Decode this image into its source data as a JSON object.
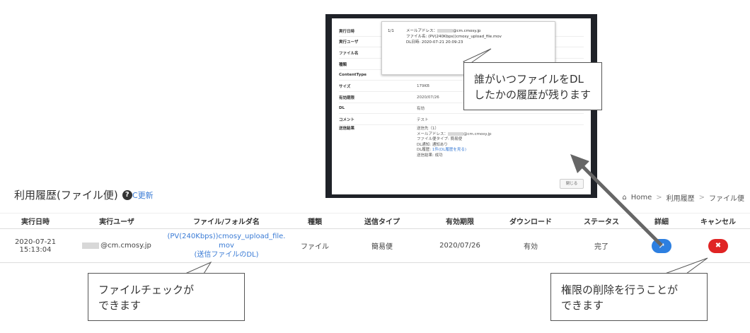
{
  "page": {
    "title": "利用履歴(ファイル便)",
    "help_icon": "?",
    "refresh_label": "更新",
    "refresh_icon": "C"
  },
  "breadcrumb": {
    "items": [
      "Home",
      "利用履歴",
      "ファイル便"
    ],
    "separator": ">"
  },
  "table": {
    "headers": [
      "実行日時",
      "実行ユーザ",
      "ファイル/フォルダ名",
      "種類",
      "送信タイプ",
      "有効期限",
      "ダウンロード",
      "ステータス",
      "詳細",
      "キャンセル"
    ],
    "row": {
      "datetime": "2020-07-21 15:13:04",
      "user": "@cm.cmosy.jp",
      "file_line1": "(PV(240Kbps))cmosy_upload_file.",
      "file_line2": "mov",
      "file_line3": "(送信ファイルのDL)",
      "type": "ファイル",
      "send_type": "簡易便",
      "expiry": "2020/07/26",
      "download": "有効",
      "status": "完了"
    },
    "detail_icon": "↗",
    "cancel_icon": "✖"
  },
  "modal": {
    "rows": [
      {
        "k": "実行日時",
        "v": ""
      },
      {
        "k": "実行ユーザ",
        "v": ""
      },
      {
        "k": "ファイル名",
        "v": ""
      },
      {
        "k": "種類",
        "v": ""
      },
      {
        "k": "ContentType",
        "v": ""
      },
      {
        "k": "サイズ",
        "v": "179KB"
      },
      {
        "k": "有効期限",
        "v": "2020/07/26"
      },
      {
        "k": "DL",
        "v": "有効"
      },
      {
        "k": "コメント",
        "v": "テスト"
      },
      {
        "k": "送信結果",
        "v": ""
      }
    ],
    "result": {
      "line1": "送信先（1）",
      "line2": "メールアドレス：",
      "line2b": "@cm.cmosy.jp",
      "line3": "ファイル便タイプ: 簡易便",
      "line4": "DL通知: 通知あり",
      "line5": "DL履歴: ",
      "line5_link": "1件(DL履歴を見る)",
      "line6": "送信結果: 成功"
    },
    "close_label": "閉じる",
    "popover": {
      "num": "1/1",
      "line1": "メールアドレス：",
      "line1b": "@cm.cmosy.jp",
      "line2": "ファイル名: (PV(240Kbps))cmosy_upload_file.mov",
      "line3": "DL日時: 2020-07-21 20:09:23"
    }
  },
  "callouts": {
    "history": [
      "誰がいつファイルをDL",
      "したかの履歴が残ります"
    ],
    "file_check": [
      "ファイルチェックが",
      "できます"
    ],
    "cancel": [
      "権限の削除を行うことが",
      "できます"
    ]
  },
  "colors": {
    "accent": "#2d7fe0",
    "danger": "#e02424",
    "link": "#3a7bd5"
  }
}
